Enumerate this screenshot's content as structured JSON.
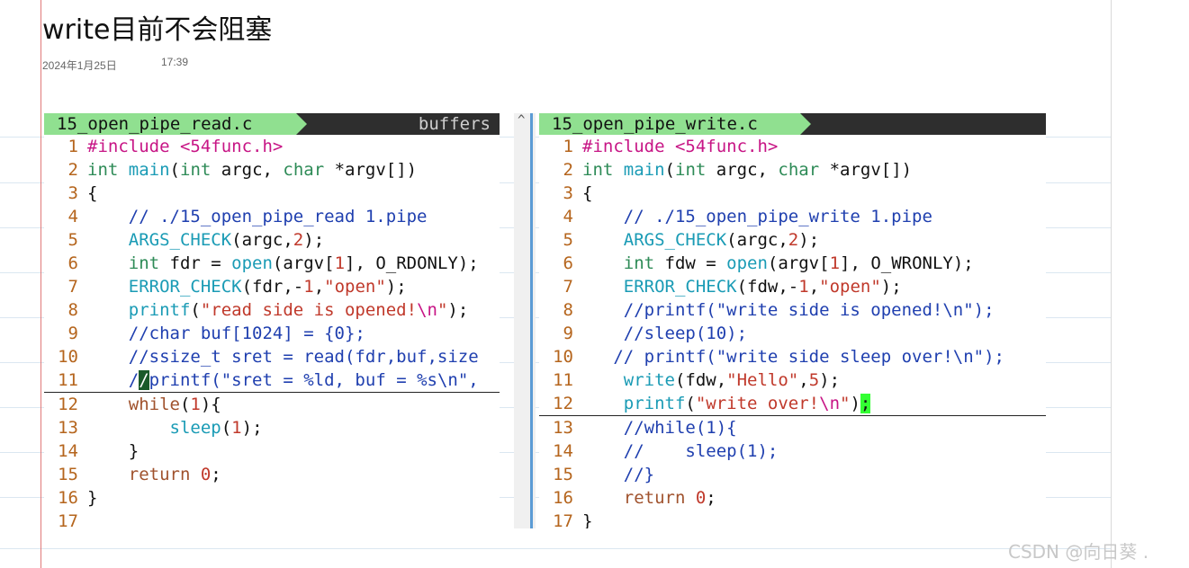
{
  "page": {
    "title": "write目前不会阻塞",
    "date": "2024年1月25日",
    "time": "17:39",
    "watermark": "CSDN @向日葵 ."
  },
  "left_pane": {
    "tab_label": "15_open_pipe_read.c",
    "buffers_label": "buffers",
    "lines": [
      {
        "n": "1",
        "tokens": [
          [
            "pre",
            "#include <54func.h>"
          ]
        ]
      },
      {
        "n": "2",
        "tokens": [
          [
            "type",
            "int"
          ],
          [
            "plain",
            " "
          ],
          [
            "fn",
            "main"
          ],
          [
            "plain",
            "("
          ],
          [
            "type",
            "int"
          ],
          [
            "plain",
            " argc, "
          ],
          [
            "type",
            "char"
          ],
          [
            "plain",
            " *argv[])"
          ]
        ]
      },
      {
        "n": "3",
        "tokens": [
          [
            "plain",
            "{"
          ]
        ]
      },
      {
        "n": "4",
        "tokens": [
          [
            "com",
            "    // ./15_open_pipe_read 1.pipe"
          ]
        ]
      },
      {
        "n": "5",
        "tokens": [
          [
            "fn",
            "    ARGS_CHECK"
          ],
          [
            "plain",
            "(argc,"
          ],
          [
            "num",
            "2"
          ],
          [
            "plain",
            ");"
          ]
        ]
      },
      {
        "n": "6",
        "tokens": [
          [
            "type",
            "    int"
          ],
          [
            "plain",
            " fdr = "
          ],
          [
            "fn",
            "open"
          ],
          [
            "plain",
            "(argv["
          ],
          [
            "num",
            "1"
          ],
          [
            "plain",
            "], O_RDONLY);"
          ]
        ]
      },
      {
        "n": "7",
        "tokens": [
          [
            "fn",
            "    ERROR_CHECK"
          ],
          [
            "plain",
            "(fdr,-"
          ],
          [
            "num",
            "1"
          ],
          [
            "plain",
            ","
          ],
          [
            "str",
            "\"open\""
          ],
          [
            "plain",
            ");"
          ]
        ]
      },
      {
        "n": "8",
        "tokens": [
          [
            "fn",
            "    printf"
          ],
          [
            "plain",
            "("
          ],
          [
            "str",
            "\"read side is opened!"
          ],
          [
            "esc",
            "\\n"
          ],
          [
            "str",
            "\""
          ],
          [
            "plain",
            ");"
          ]
        ]
      },
      {
        "n": "9",
        "tokens": [
          [
            "com",
            "    //char buf[1024] = {0};"
          ]
        ]
      },
      {
        "n": "10",
        "tokens": [
          [
            "com",
            "    //ssize_t sret = read(fdr,buf,size"
          ]
        ]
      },
      {
        "n": "11",
        "cursor": true,
        "tokens": [
          [
            "com",
            "    /"
          ],
          [
            "cursor",
            "/"
          ],
          [
            "com",
            "printf(\"sret = %ld, buf = %s\\n\","
          ]
        ]
      },
      {
        "n": "12",
        "tokens": [
          [
            "kw",
            "    while"
          ],
          [
            "plain",
            "("
          ],
          [
            "num",
            "1"
          ],
          [
            "plain",
            "){"
          ]
        ]
      },
      {
        "n": "13",
        "tokens": [
          [
            "fn",
            "        sleep"
          ],
          [
            "plain",
            "("
          ],
          [
            "num",
            "1"
          ],
          [
            "plain",
            ");"
          ]
        ]
      },
      {
        "n": "14",
        "tokens": [
          [
            "plain",
            "    }"
          ]
        ]
      },
      {
        "n": "15",
        "tokens": [
          [
            "kw",
            "    return"
          ],
          [
            "plain",
            " "
          ],
          [
            "num",
            "0"
          ],
          [
            "plain",
            ";"
          ]
        ]
      },
      {
        "n": "16",
        "tokens": [
          [
            "plain",
            "}"
          ]
        ]
      },
      {
        "n": "17",
        "tokens": []
      }
    ]
  },
  "right_pane": {
    "tab_label": "15_open_pipe_write.c",
    "split_marker": "^",
    "lines": [
      {
        "n": "1",
        "tokens": [
          [
            "pre",
            "#include <54func.h>"
          ]
        ]
      },
      {
        "n": "2",
        "tokens": [
          [
            "type",
            "int"
          ],
          [
            "plain",
            " "
          ],
          [
            "fn",
            "main"
          ],
          [
            "plain",
            "("
          ],
          [
            "type",
            "int"
          ],
          [
            "plain",
            " argc, "
          ],
          [
            "type",
            "char"
          ],
          [
            "plain",
            " *argv[])"
          ]
        ]
      },
      {
        "n": "3",
        "tokens": [
          [
            "plain",
            "{"
          ]
        ]
      },
      {
        "n": "4",
        "tokens": [
          [
            "com",
            "    // ./15_open_pipe_write 1.pipe"
          ]
        ]
      },
      {
        "n": "5",
        "tokens": [
          [
            "fn",
            "    ARGS_CHECK"
          ],
          [
            "plain",
            "(argc,"
          ],
          [
            "num",
            "2"
          ],
          [
            "plain",
            ");"
          ]
        ]
      },
      {
        "n": "6",
        "tokens": [
          [
            "type",
            "    int"
          ],
          [
            "plain",
            " fdw = "
          ],
          [
            "fn",
            "open"
          ],
          [
            "plain",
            "(argv["
          ],
          [
            "num",
            "1"
          ],
          [
            "plain",
            "], O_WRONLY);"
          ]
        ]
      },
      {
        "n": "7",
        "tokens": [
          [
            "fn",
            "    ERROR_CHECK"
          ],
          [
            "plain",
            "(fdw,-"
          ],
          [
            "num",
            "1"
          ],
          [
            "plain",
            ","
          ],
          [
            "str",
            "\"open\""
          ],
          [
            "plain",
            ");"
          ]
        ]
      },
      {
        "n": "8",
        "tokens": [
          [
            "com",
            "    //printf(\"write side is opened!\\n\");"
          ]
        ]
      },
      {
        "n": "9",
        "tokens": [
          [
            "com",
            "    //sleep(10);"
          ]
        ]
      },
      {
        "n": "10",
        "tokens": [
          [
            "com",
            "   // printf(\"write side sleep over!\\n\");"
          ]
        ]
      },
      {
        "n": "11",
        "tokens": [
          [
            "fn",
            "    write"
          ],
          [
            "plain",
            "(fdw,"
          ],
          [
            "str",
            "\"Hello\""
          ],
          [
            "plain",
            ","
          ],
          [
            "num",
            "5"
          ],
          [
            "plain",
            ");"
          ]
        ]
      },
      {
        "n": "12",
        "cursor": true,
        "tokens": [
          [
            "fn",
            "    printf"
          ],
          [
            "plain",
            "("
          ],
          [
            "str",
            "\"write over!"
          ],
          [
            "esc",
            "\\n"
          ],
          [
            "str",
            "\""
          ],
          [
            "plain",
            ")"
          ],
          [
            "cursorgreen",
            ";"
          ]
        ]
      },
      {
        "n": "13",
        "tokens": [
          [
            "com",
            "    //while(1){"
          ]
        ]
      },
      {
        "n": "14",
        "tokens": [
          [
            "com",
            "    //    sleep(1);"
          ]
        ]
      },
      {
        "n": "15",
        "tokens": [
          [
            "com",
            "    //}"
          ]
        ]
      },
      {
        "n": "16",
        "tokens": [
          [
            "kw",
            "    return"
          ],
          [
            "plain",
            " "
          ],
          [
            "num",
            "0"
          ],
          [
            "plain",
            ";"
          ]
        ]
      },
      {
        "n": "17",
        "tokens": [
          [
            "plain",
            "}"
          ]
        ]
      }
    ]
  },
  "colors": {
    "tab_active": "#90e090",
    "tabbar": "#2e2e2e",
    "line_number": "#b5651d",
    "comment": "#1f3faf",
    "type": "#2e8b57",
    "function": "#1a9bb5",
    "string": "#c0392b",
    "preprocessor": "#c71585"
  }
}
